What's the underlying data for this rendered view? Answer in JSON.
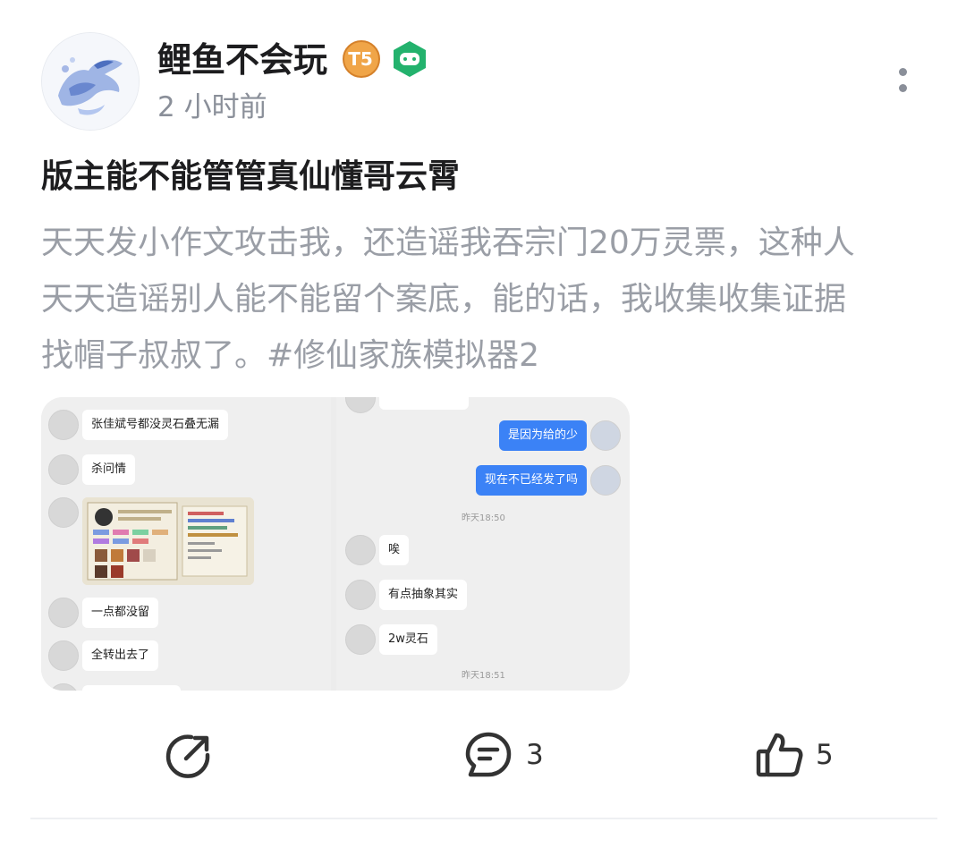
{
  "author": {
    "name": "鲤鱼不会玩",
    "level_badge": "T5",
    "icons": [
      "avatar-painting",
      "level-badge-icon",
      "gamepad-badge-icon"
    ]
  },
  "post": {
    "time": "2 小时前",
    "title": "版主能不能管管真仙懂哥云霄",
    "body_lines": [
      "天天发小作文攻击我，还造谣我吞宗门20万灵票，这种人",
      "天天造谣别人能不能留个案底，能的话，我收集收集证据",
      "找帽子叔叔了。#修仙家族模拟器2"
    ]
  },
  "gallery": {
    "left_chat": [
      "张佳斌号都没灵石叠无漏",
      "杀问情",
      "一点都没留",
      "全转出去了"
    ],
    "right_chat": {
      "mine": [
        "是因为给的少",
        "现在不已经发了吗"
      ],
      "time1": "昨天18:50",
      "theirs": [
        "唉",
        "有点抽象其实",
        "2w灵石"
      ],
      "time2": "昨天18:51"
    }
  },
  "actions": {
    "share_icon": "share-icon",
    "comment_count": "3",
    "like_count": "5"
  },
  "colors": {
    "title": "#1d1d1f",
    "body_text": "#9a9ea6",
    "meta": "#8a8f99",
    "badge_orange": "#e8933a",
    "badge_green": "#23b26d",
    "bubble_blue": "#3b82f6"
  }
}
